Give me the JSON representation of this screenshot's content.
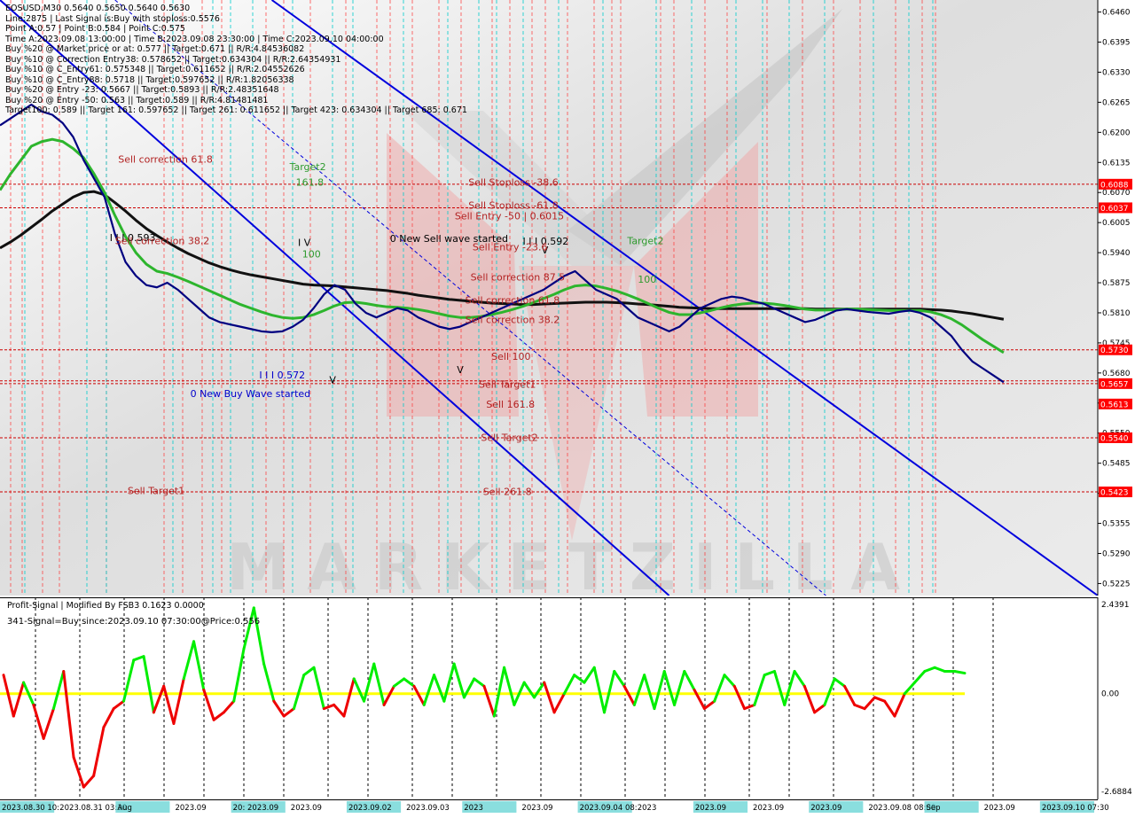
{
  "header": {
    "title": "EOSUSD,M30  0.5640 0.5650 0.5640 0.5630",
    "lines": [
      "Line:2875  | Last Signal is:Buy with stoploss:0.5576",
      "Point A:0.57 | Point B:0.584 | Point C:0.575",
      "Time A:2023.09.08 13:00:00 | Time B:2023.09.08 23:30:00 | Time C:2023.09.10 04:00:00",
      "Buy %20 @ Market price or at: 0.577 || Target:0.671 || R/R:4.84536082",
      "Buy %10 @ Correction Entry38: 0.578652 || Target:0.634304 || R/R:2.64354931",
      "Buy %10 @ C_Entry61: 0.575348 || Target:0.611652 || R/R:2.04552626",
      "Buy %10 @ C_Entry88: 0.5718 || Target:0.597652 || R/R:1.82056338",
      "Buy %20 @ Entry -23: 0.5667 || Target:0.5893 || R/R:2.48351648",
      "Buy %20 @ Entry -50: 0.563 || Target:0.589 || R/R:4.81481481",
      "Target100: 0.589 || Target 161: 0.597652 || Target 261: 0.611652 || Target 423: 0.634304 || Target 685: 0.671"
    ]
  },
  "colors": {
    "background": "#ffffff",
    "price_line": "#000080",
    "ma_fast": "#2db52d",
    "ma_slow": "#111111",
    "channel": "#0000dd",
    "level_red": "#cc0000",
    "osc_pos": "#00ee00",
    "osc_neg": "#ee0000",
    "zero_line": "#ffff00",
    "vline_red": "#ff3333",
    "vline_cyan": "#00cccc",
    "label_box": "#ff0000"
  },
  "chart_data": [
    {
      "type": "line",
      "panel": "main",
      "ylim": [
        0.5199,
        0.6486
      ],
      "y_ticks": [
        "0.6460",
        "0.6395",
        "0.6330",
        "0.6265",
        "0.6200",
        "0.6135",
        "0.6070",
        "0.6005",
        "0.5940",
        "0.5875",
        "0.5810",
        "0.5745",
        "0.5680",
        "0.5615",
        "0.5550",
        "0.5485",
        "0.5420",
        "0.5355",
        "0.5290",
        "0.5225"
      ],
      "price_tags": [
        {
          "label": "0.6088",
          "value": 0.6088
        },
        {
          "label": "0.6037",
          "value": 0.6037
        },
        {
          "label": "0.5730",
          "value": 0.573
        },
        {
          "label": "0.5657",
          "value": 0.5657
        },
        {
          "label": "0.5613",
          "value": 0.5613
        },
        {
          "label": "0.5540",
          "value": 0.554
        },
        {
          "label": "0.5423",
          "value": 0.5423
        }
      ],
      "levels": [
        0.6088,
        0.6037,
        0.573,
        0.5663,
        0.5657,
        0.554,
        0.5423
      ],
      "series": [
        {
          "values": [
            0.6215,
            0.623,
            0.6245,
            0.626,
            0.6245,
            0.6238,
            0.622,
            0.619,
            0.614,
            0.61,
            0.606,
            0.598,
            0.592,
            0.589,
            0.587,
            0.5865,
            0.5875,
            0.586,
            0.584,
            0.582,
            0.58,
            0.579,
            0.5785,
            0.578,
            0.5775,
            0.577,
            0.5768,
            0.577,
            0.578,
            0.5795,
            0.582,
            0.585,
            0.587,
            0.586,
            0.583,
            0.581,
            0.58,
            0.581,
            0.582,
            0.5815,
            0.58,
            0.579,
            0.578,
            0.5775,
            0.578,
            0.579,
            0.58,
            0.581,
            0.582,
            0.583,
            0.584,
            0.585,
            0.586,
            0.5875,
            0.589,
            0.59,
            0.588,
            0.586,
            0.585,
            0.584,
            0.582,
            0.58,
            0.579,
            0.578,
            0.577,
            0.578,
            0.58,
            0.582,
            0.583,
            0.584,
            0.5845,
            0.5842,
            0.5835,
            0.583,
            0.582,
            0.581,
            0.58,
            0.579,
            0.5795,
            0.5805,
            0.5815,
            0.5818,
            0.5815,
            0.5812,
            0.581,
            0.5808,
            0.5812,
            0.5815,
            0.581,
            0.58,
            0.578,
            0.576,
            0.573,
            0.5705,
            0.569,
            0.5675,
            0.566
          ]
        },
        {
          "values": [
            0.6075,
            0.611,
            0.614,
            0.617,
            0.618,
            0.6185,
            0.618,
            0.6165,
            0.6145,
            0.611,
            0.607,
            0.602,
            0.5975,
            0.594,
            0.5915,
            0.59,
            0.5895,
            0.5887,
            0.5878,
            0.5868,
            0.5858,
            0.5848,
            0.5838,
            0.5828,
            0.582,
            0.5812,
            0.5805,
            0.58,
            0.5798,
            0.58,
            0.5806,
            0.5815,
            0.5825,
            0.5832,
            0.5833,
            0.583,
            0.5826,
            0.5823,
            0.5822,
            0.582,
            0.5817,
            0.5813,
            0.5808,
            0.5803,
            0.58,
            0.58,
            0.5802,
            0.5806,
            0.5811,
            0.5817,
            0.5824,
            0.5832,
            0.5841,
            0.585,
            0.586,
            0.5868,
            0.587,
            0.5868,
            0.5863,
            0.5857,
            0.5849,
            0.584,
            0.583,
            0.582,
            0.5811,
            0.5806,
            0.5806,
            0.581,
            0.5815,
            0.5821,
            0.5826,
            0.5829,
            0.5831,
            0.5831,
            0.5829,
            0.5826,
            0.5822,
            0.5818,
            0.5816,
            0.5816,
            0.5817,
            0.5818,
            0.5818,
            0.5817,
            0.5816,
            0.5815,
            0.5815,
            0.5815,
            0.5815,
            0.5812,
            0.5806,
            0.5797,
            0.5784,
            0.5768,
            0.5752,
            0.5738,
            0.5724
          ]
        },
        {
          "values": [
            0.595,
            0.5963,
            0.5978,
            0.5995,
            0.6012,
            0.603,
            0.6045,
            0.606,
            0.607,
            0.6072,
            0.6065,
            0.6048,
            0.603,
            0.601,
            0.5992,
            0.5977,
            0.5963,
            0.595,
            0.5938,
            0.5928,
            0.5918,
            0.591,
            0.5903,
            0.5897,
            0.5892,
            0.5888,
            0.5884,
            0.588,
            0.5876,
            0.5872,
            0.587,
            0.5869,
            0.5868,
            0.5866,
            0.5864,
            0.5862,
            0.586,
            0.5858,
            0.5855,
            0.5852,
            0.5848,
            0.5845,
            0.5842,
            0.5839,
            0.5837,
            0.5835,
            0.5833,
            0.5831,
            0.583,
            0.5829,
            0.5828,
            0.5828,
            0.5829,
            0.583,
            0.5831,
            0.5832,
            0.5833,
            0.5833,
            0.5833,
            0.5832,
            0.5831,
            0.5829,
            0.5828,
            0.5826,
            0.5824,
            0.5822,
            0.5821,
            0.582,
            0.5819,
            0.5819,
            0.5819,
            0.5819,
            0.5819,
            0.5819,
            0.5819,
            0.5819,
            0.5819,
            0.5819,
            0.5818,
            0.5818,
            0.5818,
            0.5818,
            0.5818,
            0.5818,
            0.5818,
            0.5818,
            0.5818,
            0.5818,
            0.5818,
            0.5817,
            0.5816,
            0.5814,
            0.5811,
            0.5808,
            0.5804,
            0.58,
            0.5796
          ]
        }
      ],
      "channel": [
        {
          "line": "upper",
          "start": [
            0,
            0.6486
          ],
          "end": [
            64,
            0.5199
          ]
        },
        {
          "line": "mid",
          "start": [
            11,
            0.6486
          ],
          "end": [
            79,
            0.5199
          ]
        },
        {
          "line": "lower",
          "start": [
            26,
            0.6486
          ],
          "end": [
            105,
            0.5199
          ]
        }
      ],
      "labels": [
        {
          "text": "Sell correction 61.8",
          "color": "#b22222",
          "x": 11.3,
          "y": 0.6135
        },
        {
          "text": "Target2",
          "color": "#2e9a2e",
          "x": 27.7,
          "y": 0.6118
        },
        {
          "text": "161.8",
          "color": "#2e9a2e",
          "x": 28.3,
          "y": 0.6085
        },
        {
          "text": "I I I 0.593",
          "color": "#000000",
          "x": 10.5,
          "y": 0.5965
        },
        {
          "text": "Sell correction 38.2",
          "color": "#b22222",
          "x": 11.0,
          "y": 0.5958
        },
        {
          "text": "I V",
          "color": "#000000",
          "x": 28.5,
          "y": 0.5955
        },
        {
          "text": "100",
          "color": "#2e9a2e",
          "x": 28.9,
          "y": 0.593
        },
        {
          "text": "0 New Sell wave started",
          "color": "#000000",
          "x": 37.3,
          "y": 0.5963
        },
        {
          "text": "I I I 0.592",
          "color": "#000000",
          "x": 50.0,
          "y": 0.5957
        },
        {
          "text": "V",
          "color": "#000000",
          "x": 51.8,
          "y": 0.5938
        },
        {
          "text": "Sell Stoploss -38.6",
          "color": "#b22222",
          "x": 44.8,
          "y": 0.6085
        },
        {
          "text": "Sell Stoploss -61.8",
          "color": "#b22222",
          "x": 44.8,
          "y": 0.6035
        },
        {
          "text": "Sell Entry -50 | 0.6015",
          "color": "#b22222",
          "x": 43.5,
          "y": 0.6012
        },
        {
          "text": "Sell Entry -23.6",
          "color": "#b22222",
          "x": 45.2,
          "y": 0.5945
        },
        {
          "text": "Target2",
          "color": "#2e9a2e",
          "x": 60.0,
          "y": 0.5958
        },
        {
          "text": "Sell correction 87.5",
          "color": "#b22222",
          "x": 45.0,
          "y": 0.588
        },
        {
          "text": "100",
          "color": "#2e9a2e",
          "x": 61.0,
          "y": 0.5875
        },
        {
          "text": "Sell correction 61.8",
          "color": "#b22222",
          "x": 44.5,
          "y": 0.583
        },
        {
          "text": "Sell correction 38.2",
          "color": "#b22222",
          "x": 44.5,
          "y": 0.5788
        },
        {
          "text": "Sell 100",
          "color": "#b22222",
          "x": 47.0,
          "y": 0.5708
        },
        {
          "text": "I I I 0.572",
          "color": "#0000cc",
          "x": 24.8,
          "y": 0.5668
        },
        {
          "text": "V",
          "color": "#000000",
          "x": 31.5,
          "y": 0.5658
        },
        {
          "text": "V",
          "color": "#000000",
          "x": 43.7,
          "y": 0.568
        },
        {
          "text": "Sell Target1",
          "color": "#b22222",
          "x": 45.8,
          "y": 0.5648
        },
        {
          "text": "0 New Buy Wave started",
          "color": "#0000cc",
          "x": 18.2,
          "y": 0.5628
        },
        {
          "text": "Sell 161.8",
          "color": "#b22222",
          "x": 46.5,
          "y": 0.5605
        },
        {
          "text": "Sell Target2",
          "color": "#b22222",
          "x": 46.0,
          "y": 0.5533
        },
        {
          "text": "Sell Target1",
          "color": "#b22222",
          "x": 12.2,
          "y": 0.5418
        },
        {
          "text": "Sell  261.8",
          "color": "#b22222",
          "x": 46.2,
          "y": 0.5416
        }
      ]
    },
    {
      "type": "line",
      "panel": "indicator",
      "title": "Profit-Signal | Modified By FSB3 0.1623 0.0000",
      "subtitle": "341-Signal=Buy since:2023.09.10 07:30:00@Price:0.556",
      "ylim": [
        -2.6884,
        2.4391
      ],
      "y_ticks": [
        "2.4391",
        "0.00",
        "-2.6884"
      ],
      "zero": 0.0,
      "x": [
        0,
        1,
        2,
        3,
        4,
        5,
        6,
        7,
        8,
        9,
        10,
        11,
        12,
        13,
        14,
        15,
        16,
        17,
        18,
        19,
        20,
        21,
        22,
        23,
        24,
        25,
        26,
        27,
        28,
        29,
        30,
        31,
        32,
        33,
        34,
        35,
        36,
        37,
        38,
        39,
        40,
        41,
        42,
        43,
        44,
        45,
        46,
        47,
        48,
        49,
        50,
        51,
        52,
        53,
        54,
        55,
        56,
        57,
        58,
        59,
        60,
        61,
        62,
        63,
        64,
        65,
        66,
        67,
        68,
        69,
        70,
        71,
        72,
        73,
        74,
        75,
        76,
        77,
        78,
        79,
        80,
        81,
        82,
        83,
        84,
        85,
        86,
        87,
        88,
        89,
        90,
        91,
        92,
        93,
        94,
        95,
        96
      ],
      "values": [
        0.5,
        -0.6,
        0.3,
        -0.3,
        -1.2,
        -0.4,
        0.6,
        -1.7,
        -2.5,
        -2.2,
        -0.9,
        -0.4,
        -0.2,
        0.9,
        1.0,
        -0.5,
        0.2,
        -0.8,
        0.4,
        1.4,
        0.1,
        -0.7,
        -0.5,
        -0.2,
        1.2,
        2.3,
        0.8,
        -0.2,
        -0.6,
        -0.4,
        0.5,
        0.7,
        -0.4,
        -0.3,
        -0.6,
        0.4,
        -0.2,
        0.8,
        -0.3,
        0.2,
        0.4,
        0.2,
        -0.3,
        0.5,
        -0.2,
        0.8,
        -0.1,
        0.4,
        0.2,
        -0.6,
        0.7,
        -0.3,
        0.3,
        -0.1,
        0.3,
        -0.5,
        0.0,
        0.5,
        0.3,
        0.7,
        -0.5,
        0.6,
        0.2,
        -0.3,
        0.5,
        -0.4,
        0.6,
        -0.3,
        0.6,
        0.1,
        -0.4,
        -0.2,
        0.5,
        0.2,
        -0.4,
        -0.3,
        0.5,
        0.6,
        -0.3,
        0.6,
        0.2,
        -0.5,
        -0.3,
        0.4,
        0.2,
        -0.3,
        -0.4,
        -0.1,
        -0.2,
        -0.6,
        0.0,
        0.3,
        0.6,
        0.7,
        0.6,
        0.6,
        0.55
      ]
    }
  ],
  "indicator_axis": {
    "top": "2.4391",
    "zero": "0.00",
    "bottom": "-2.6884"
  },
  "time_axis": [
    "2023.08.30 10:",
    "2023.08.31 03:30",
    "Aug",
    "2023.09",
    "20: 2023.09",
    "2023.09",
    "2023.09.02",
    "2023.09.03",
    "2023",
    "2023.09",
    "2023.09.04 08:",
    "2023",
    "2023.09",
    "2023.09",
    "2023.09",
    "2023.09.08 08:00",
    "Sep",
    "2023.09",
    "2023.09.10 07:30"
  ],
  "watermark": "MARKETZILLA"
}
